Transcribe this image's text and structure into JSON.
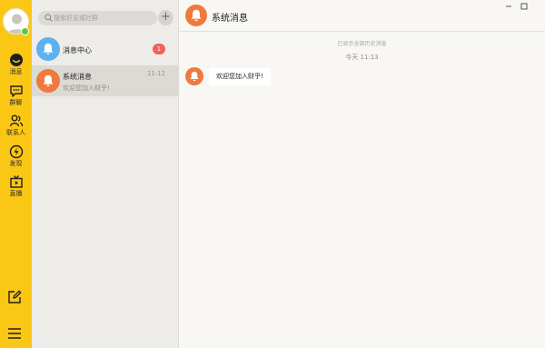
{
  "nav": {
    "items": [
      {
        "label": "消息",
        "icon": "chat-bubble-icon"
      },
      {
        "label": "群聊",
        "icon": "group-chat-icon"
      },
      {
        "label": "联系人",
        "icon": "contacts-icon"
      },
      {
        "label": "发现",
        "icon": "discover-icon"
      },
      {
        "label": "直播",
        "icon": "live-tv-icon"
      }
    ],
    "bottom_icons": [
      "edit-icon",
      "menu-icon"
    ]
  },
  "search": {
    "placeholder": "搜索好友或社群"
  },
  "conversations": [
    {
      "name": "消息中心",
      "preview": "",
      "time": "",
      "unread": "1",
      "icon": "bell-icon"
    },
    {
      "name": "系统消息",
      "preview": "欢迎您加入财乎!",
      "time": "11:12",
      "icon": "bell-icon"
    }
  ],
  "chat": {
    "title": "系统消息",
    "history_note": "已显示全部历史消息",
    "time_note": "今天 11:13",
    "messages": [
      {
        "text": "欢迎您加入财乎!"
      }
    ]
  },
  "window": {
    "controls": [
      "minimize-icon",
      "maximize-icon"
    ]
  },
  "colors": {
    "rail": "#fbc715",
    "list_bg": "#edece8",
    "chat_bg": "#f8f7f3",
    "system_icon": "#f07a3e",
    "center_icon": "#5eb1f0",
    "badge": "#f2605d",
    "online": "#5ccb3a"
  }
}
